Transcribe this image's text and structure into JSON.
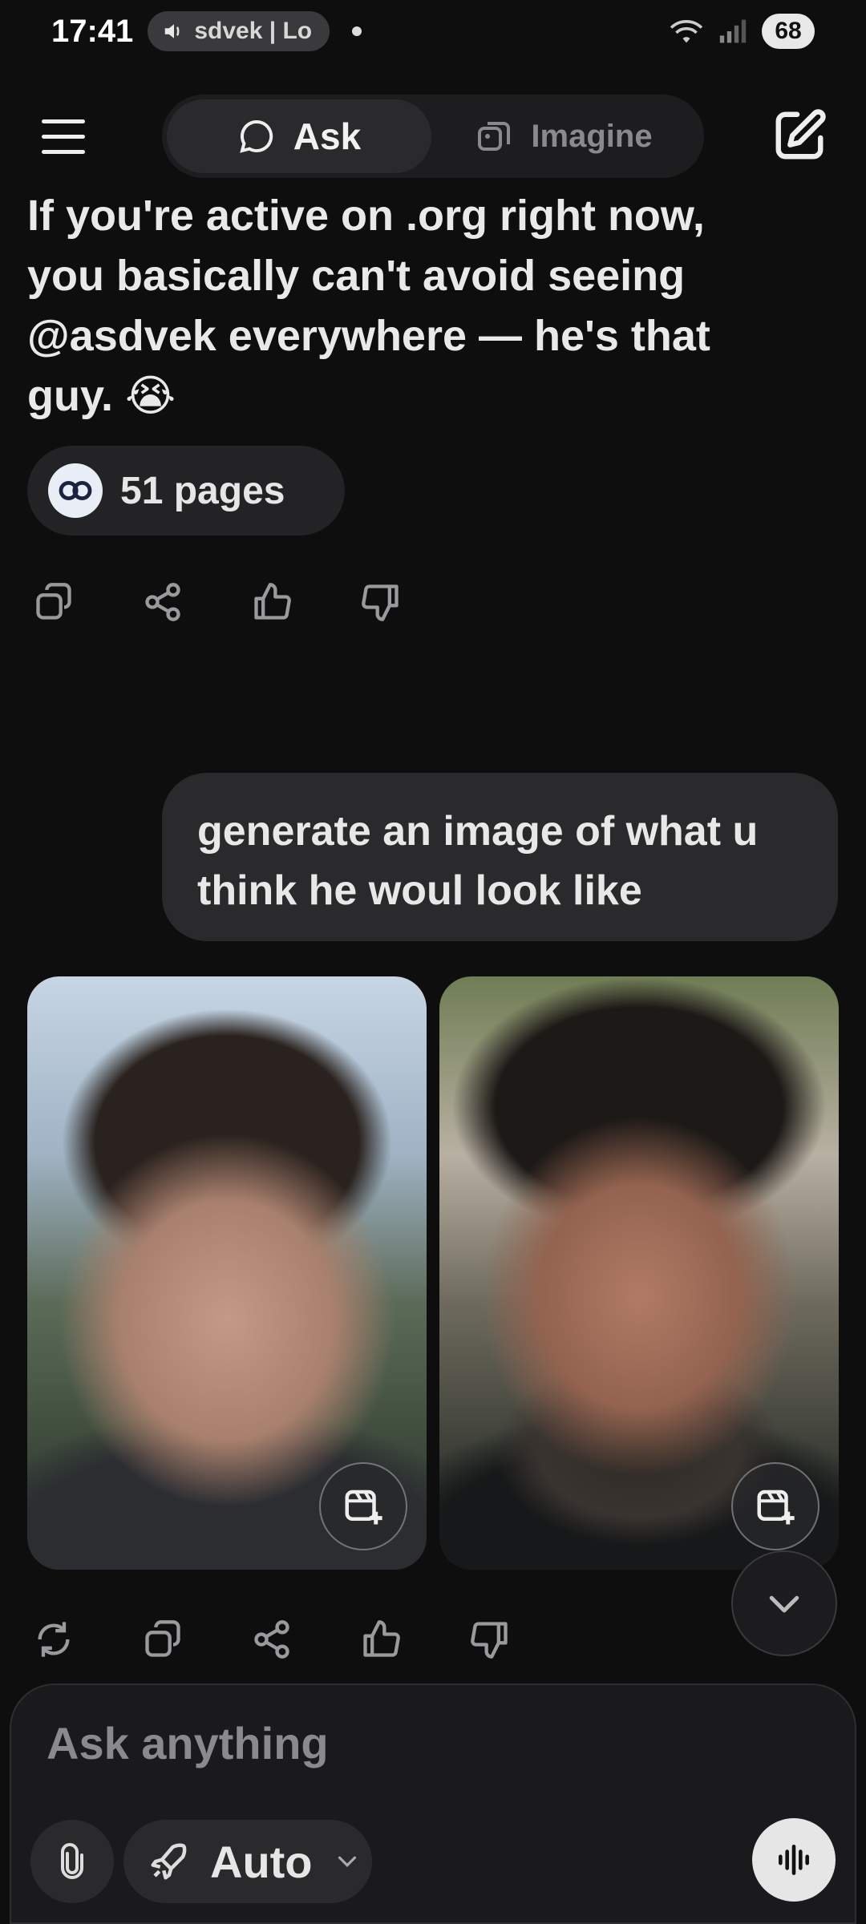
{
  "status_bar": {
    "time": "17:41",
    "media_text": "sdvek | Lo",
    "battery": "68"
  },
  "nav": {
    "ask_label": "Ask",
    "imagine_label": "Imagine"
  },
  "answer": {
    "line1": "If you're active on .org right now,",
    "line2": "you basically can't avoid seeing",
    "line3": "@asdvek everywhere — he's that",
    "line4": "guy. 😭",
    "pages_label": "51 pages"
  },
  "user_message": {
    "text": "generate an image of what u think he woul look like"
  },
  "composer": {
    "placeholder": "Ask anything",
    "mode": "Auto"
  },
  "icons": {
    "copy": "copy-icon",
    "share": "share-icon",
    "like": "thumbs-up-icon",
    "dislike": "thumbs-down-icon",
    "regenerate": "refresh-icon"
  }
}
